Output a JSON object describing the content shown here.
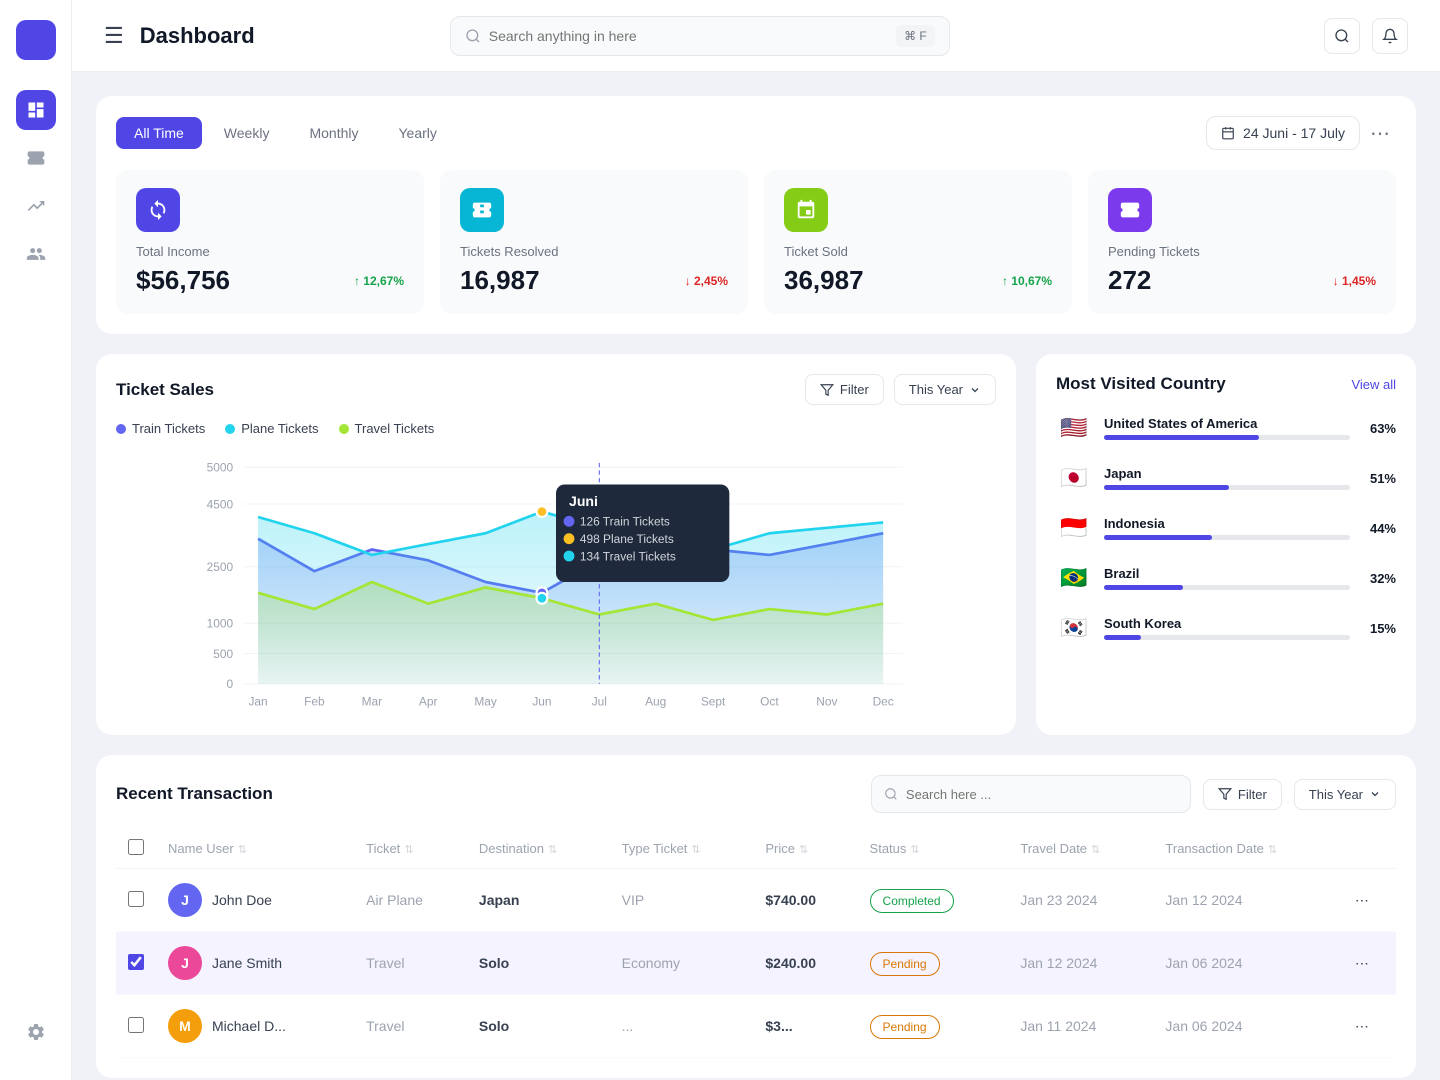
{
  "app": {
    "title": "Dashboard"
  },
  "topbar": {
    "search_placeholder": "Search anything in here",
    "kbd": "⌘ F"
  },
  "filter_tabs": {
    "tabs": [
      "All Time",
      "Weekly",
      "Monthly",
      "Yearly"
    ],
    "active": "All Time"
  },
  "date_range": {
    "label": "24 Juni - 17 July"
  },
  "stats": [
    {
      "label": "Total Income",
      "value": "$56,756",
      "change": "↑ 12,67%",
      "direction": "up",
      "icon": "↻",
      "color": "blue"
    },
    {
      "label": "Tickets Resolved",
      "value": "16,987",
      "change": "↓ 2,45%",
      "direction": "down",
      "icon": "🎫",
      "color": "teal"
    },
    {
      "label": "Ticket Sold",
      "value": "36,987",
      "change": "↑ 10,67%",
      "direction": "up",
      "icon": "🏷",
      "color": "green"
    },
    {
      "label": "Pending Tickets",
      "value": "272",
      "change": "↓ 1,45%",
      "direction": "down",
      "icon": "🎟",
      "color": "purple"
    }
  ],
  "chart": {
    "title": "Ticket Sales",
    "year_label": "This Year",
    "filter_label": "Filter",
    "legend": [
      {
        "name": "Train Tickets",
        "color": "#6366f1"
      },
      {
        "name": "Plane Tickets",
        "color": "#22d3ee"
      },
      {
        "name": "Travel Tickets",
        "color": "#a3e635"
      }
    ],
    "x_labels": [
      "Jan",
      "Feb",
      "Mar",
      "Apr",
      "May",
      "Jun",
      "Jul",
      "Aug",
      "Sept",
      "Oct",
      "Nov",
      "Dec"
    ],
    "y_labels": [
      "5000",
      "4500",
      "2500",
      "1000",
      "500",
      "0"
    ],
    "tooltip": {
      "month": "Juni",
      "rows": [
        {
          "label": "Train Tickets",
          "value": "126",
          "color": "#6366f1"
        },
        {
          "label": "Plane Tickets",
          "value": "498",
          "color": "#fbbf24"
        },
        {
          "label": "Travel Tickets",
          "value": "134",
          "color": "#22d3ee"
        }
      ]
    }
  },
  "countries": {
    "title": "Most Visited Country",
    "view_all": "View all",
    "items": [
      {
        "name": "United States of America",
        "pct": 63,
        "pct_label": "63%",
        "flag": "🇺🇸"
      },
      {
        "name": "Japan",
        "pct": 51,
        "pct_label": "51%",
        "flag": "🇯🇵"
      },
      {
        "name": "Indonesia",
        "pct": 44,
        "pct_label": "44%",
        "flag": "🇮🇩"
      },
      {
        "name": "Brazil",
        "pct": 32,
        "pct_label": "32%",
        "flag": "🇧🇷"
      },
      {
        "name": "South Korea",
        "pct": 15,
        "pct_label": "15%",
        "flag": "🇰🇷"
      }
    ]
  },
  "transactions": {
    "title": "Recent Transaction",
    "search_placeholder": "Search here ...",
    "filter_label": "Filter",
    "year_label": "This Year",
    "columns": [
      "Name User",
      "Ticket",
      "Destination",
      "Type Ticket",
      "Price",
      "Status",
      "Travel Date",
      "Transaction Date"
    ],
    "rows": [
      {
        "name": "John Doe",
        "ticket": "Air Plane",
        "destination": "Japan",
        "type": "VIP",
        "price": "$740.00",
        "status": "Completed",
        "status_type": "completed",
        "travel_date": "Jan 23 2024",
        "transaction_date": "Jan 12 2024",
        "checked": false,
        "avatar_color": "#6366f1",
        "avatar_letter": "J"
      },
      {
        "name": "Jane Smith",
        "ticket": "Travel",
        "destination": "Solo",
        "type": "Economy",
        "price": "$240.00",
        "status": "Pending",
        "status_type": "pending",
        "travel_date": "Jan 12 2024",
        "transaction_date": "Jan 06 2024",
        "checked": true,
        "avatar_color": "#ec4899",
        "avatar_letter": "J"
      },
      {
        "name": "Michael D...",
        "ticket": "Travel",
        "destination": "Solo",
        "type": "...",
        "price": "$3...",
        "status": "Pending",
        "status_type": "pending",
        "travel_date": "Jan 11 2024",
        "transaction_date": "Jan 06 2024",
        "checked": false,
        "avatar_color": "#f59e0b",
        "avatar_letter": "M"
      }
    ]
  }
}
